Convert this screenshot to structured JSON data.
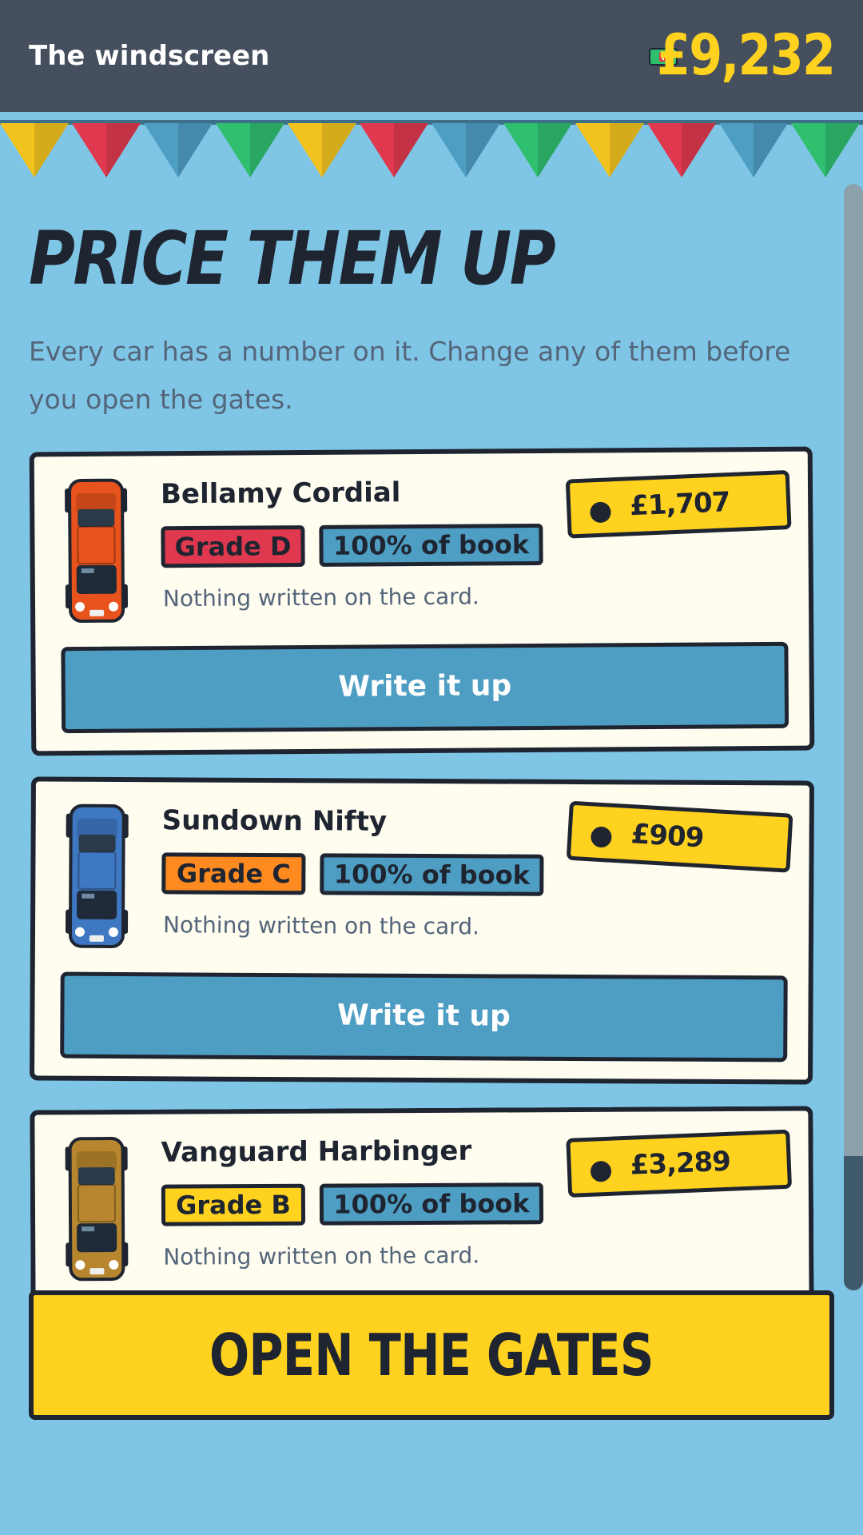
{
  "header": {
    "title": "The windscreen",
    "balance": "£9,232",
    "cash_icon": "banknote-icon"
  },
  "bunting_colors": [
    "#f2c31e",
    "#e0394f",
    "#4e9ec4",
    "#2fbf6f"
  ],
  "page": {
    "heading": "PRICE THEM UP",
    "intro": "Every car has a number on it. Change any of them before you open the gates."
  },
  "cars": [
    {
      "name": "Bellamy Cordial",
      "grade": "Grade D",
      "grade_color": "#e0394f",
      "book": "100% of book",
      "note": "Nothing written on the card.",
      "price": "£1,707",
      "button": "Write it up",
      "car_color": "#e8531d"
    },
    {
      "name": "Sundown Nifty",
      "grade": "Grade C",
      "grade_color": "#ff8a20",
      "book": "100% of book",
      "note": "Nothing written on the card.",
      "price": "£909",
      "button": "Write it up",
      "car_color": "#3f78c2"
    },
    {
      "name": "Vanguard Harbinger",
      "grade": "Grade B",
      "grade_color": "#ffd21f",
      "book": "100% of book",
      "note": "Nothing written on the card.",
      "price": "£3,289",
      "car_color": "#b8862e"
    }
  ],
  "footer": {
    "cta": "OPEN THE GATES"
  }
}
